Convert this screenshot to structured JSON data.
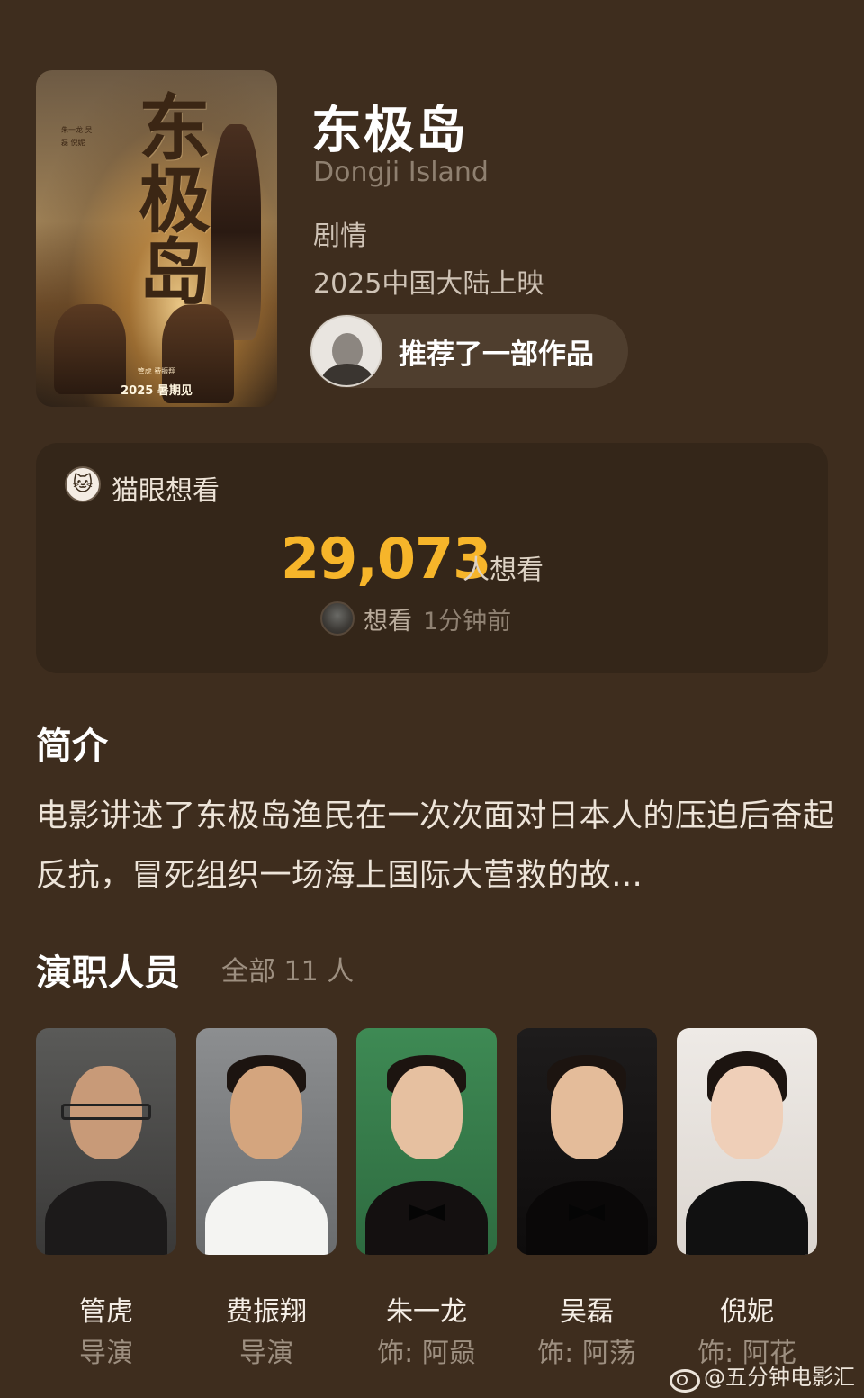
{
  "movie": {
    "poster": {
      "title_art": "东极岛",
      "cast_lines": "朱一龙 吴磊 倪妮",
      "credit": "管虎 费振翔",
      "tagline": "2025 暑期见"
    },
    "title": "东极岛",
    "english_title": "Dongji Island",
    "genre": "剧情",
    "release": "2025中国大陆上映",
    "recommend_text": "推荐了一部作品"
  },
  "maoyan": {
    "icon": "maoyan-cat-icon",
    "label": "猫眼想看",
    "want_count": "29,073",
    "want_unit": "人想看",
    "recent_action": "想看",
    "recent_time": "1分钟前",
    "accent_color": "#f6b52a"
  },
  "synopsis": {
    "title": "简介",
    "text": "电影讲述了东极岛渔民在一次次面对日本人的压迫后奋起反抗，冒死组织一场海上国际大营救的故…"
  },
  "cast": {
    "title": "演职人员",
    "count_label": "全部 11 人",
    "members": [
      {
        "name": "管虎",
        "role": "导演"
      },
      {
        "name": "费振翔",
        "role": "导演"
      },
      {
        "name": "朱一龙",
        "role": "饰: 阿赑"
      },
      {
        "name": "吴磊",
        "role": "饰: 阿荡"
      },
      {
        "name": "倪妮",
        "role": "饰: 阿花"
      }
    ]
  },
  "watermark": {
    "icon": "weibo-icon",
    "text": "@五分钟电影汇"
  }
}
